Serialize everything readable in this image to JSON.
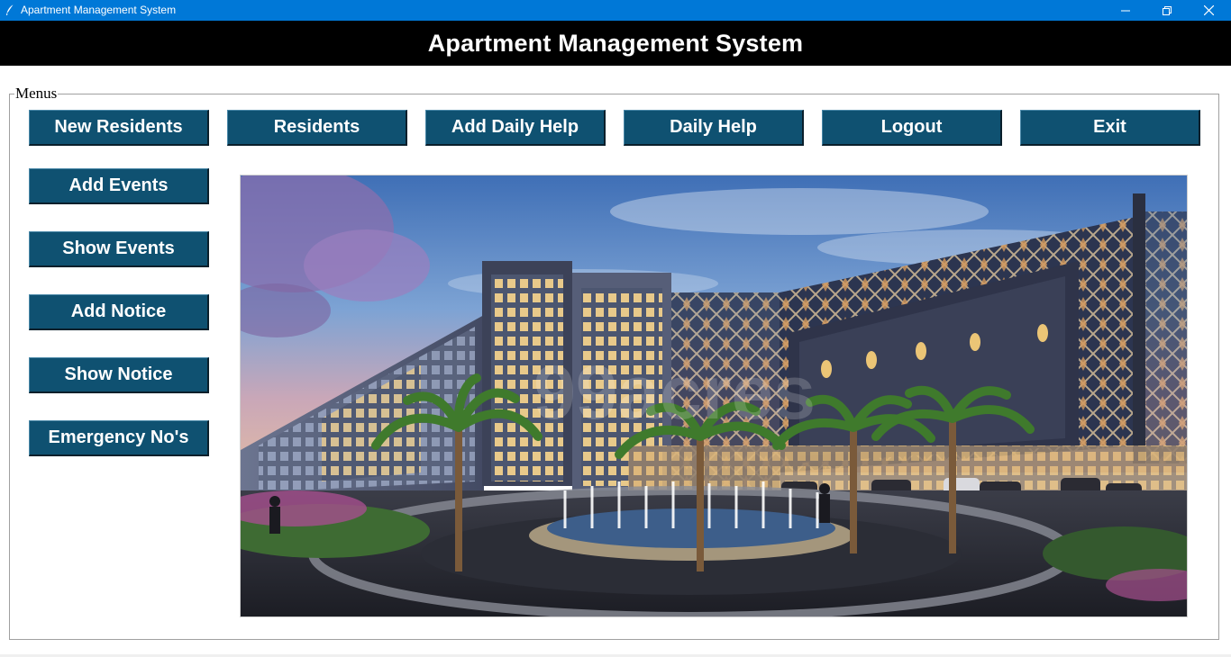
{
  "window": {
    "title": "Apartment Management System",
    "titlebar_color": "#0078d7",
    "controls": [
      "minimize-icon",
      "restore-icon",
      "close-icon"
    ]
  },
  "header": {
    "title": "Apartment Management System",
    "background": "#000000"
  },
  "menus": {
    "label": "Menus",
    "top_buttons": [
      "New Residents",
      "Residents",
      "Add Daily Help",
      "Daily Help",
      "Logout",
      "Exit"
    ],
    "side_buttons": [
      "Add Events",
      "Show Events",
      "Add Notice",
      "Show Notice",
      "Emergency No's"
    ],
    "button_color": "#0f5171"
  },
  "photo": {
    "watermark": "99acres"
  }
}
